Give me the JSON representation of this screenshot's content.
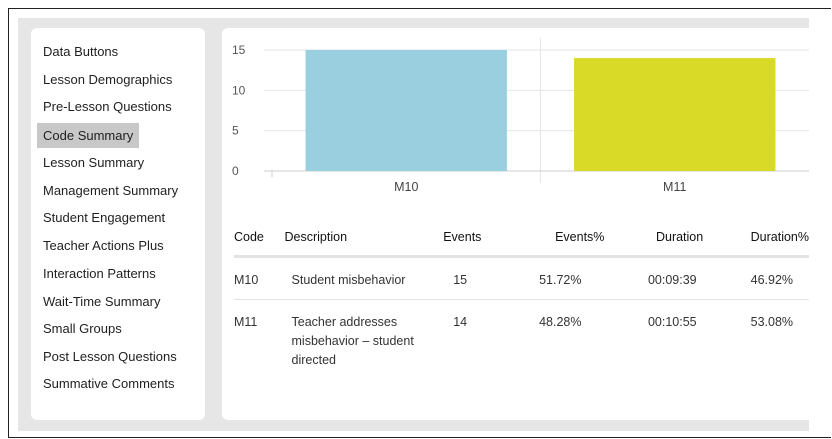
{
  "sidebar": {
    "items": [
      {
        "label": "Data Buttons",
        "active": false
      },
      {
        "label": "Lesson Demographics",
        "active": false
      },
      {
        "label": "Pre-Lesson Questions",
        "active": false
      },
      {
        "label": "Code Summary",
        "active": true
      },
      {
        "label": "Lesson Summary",
        "active": false
      },
      {
        "label": "Management Summary",
        "active": false
      },
      {
        "label": "Student Engagement",
        "active": false
      },
      {
        "label": "Teacher Actions Plus",
        "active": false
      },
      {
        "label": "Interaction Patterns",
        "active": false
      },
      {
        "label": "Wait-Time Summary",
        "active": false
      },
      {
        "label": "Small Groups",
        "active": false
      },
      {
        "label": "Post Lesson Questions",
        "active": false
      },
      {
        "label": "Summative Comments",
        "active": false
      }
    ]
  },
  "chart_data": {
    "type": "bar",
    "categories": [
      "M10",
      "M11"
    ],
    "values": [
      15,
      14
    ],
    "colors": [
      "#9acfe0",
      "#d9d927"
    ],
    "ylim": [
      0,
      15
    ],
    "yticks": [
      "0",
      "5",
      "10",
      "15"
    ],
    "grid": true,
    "title": "",
    "xlabel": "",
    "ylabel": ""
  },
  "table": {
    "headers": {
      "code": "Code",
      "description": "Description",
      "events": "Events",
      "events_pct": "Events%",
      "duration": "Duration",
      "duration_pct": "Duration%"
    },
    "rows": [
      {
        "code": "M10",
        "description": "Student misbehavior",
        "events": "15",
        "events_pct": "51.72%",
        "duration": "00:09:39",
        "duration_pct": "46.92%"
      },
      {
        "code": "M11",
        "description": "Teacher addresses misbehavior – student directed",
        "events": "14",
        "events_pct": "48.28%",
        "duration": "00:10:55",
        "duration_pct": "53.08%"
      }
    ]
  }
}
